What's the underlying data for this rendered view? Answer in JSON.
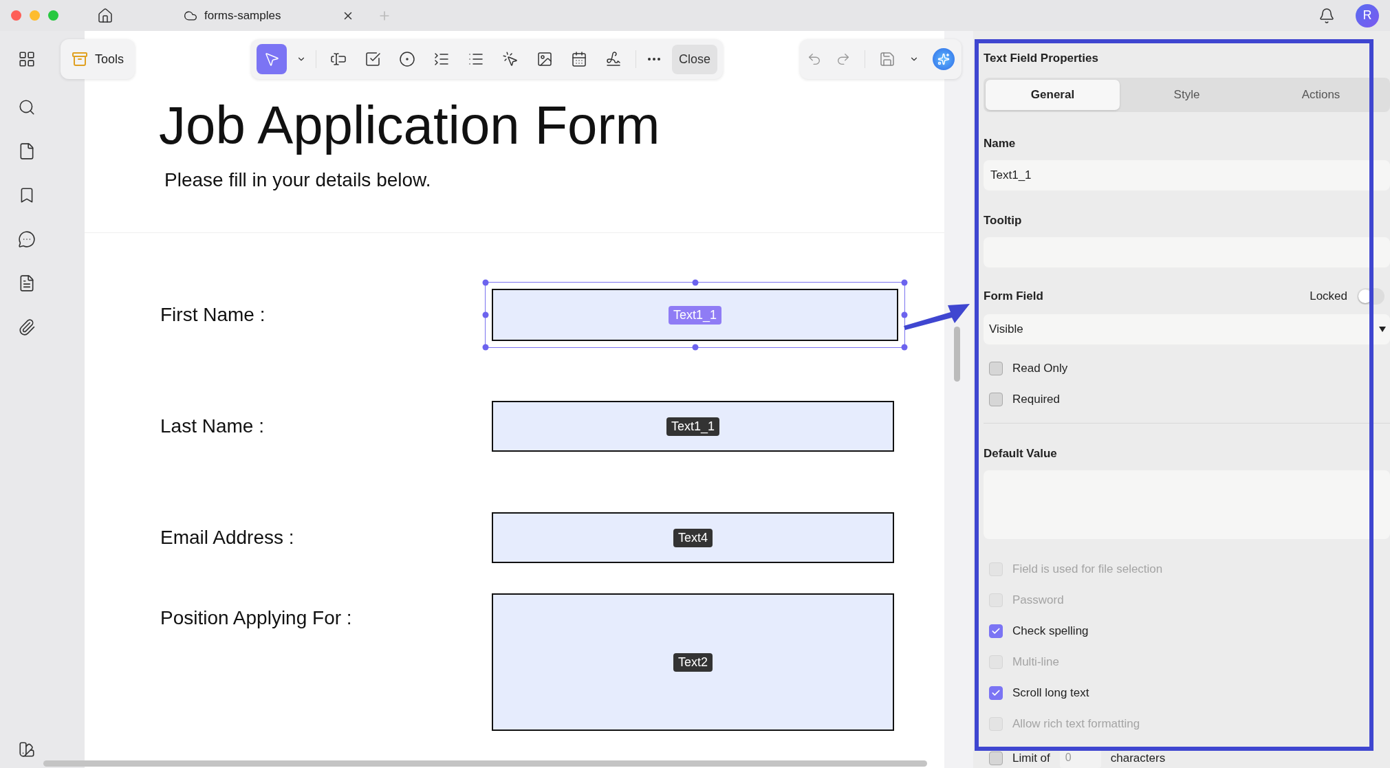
{
  "window": {
    "tab_title": "forms-samples",
    "avatar": "R"
  },
  "toolbar": {
    "tools_label": "Tools",
    "close_label": "Close",
    "tools": [
      {
        "kind": "select",
        "selected": true
      },
      {
        "kind": "text-field",
        "selected": false
      },
      {
        "kind": "checkbox",
        "selected": false
      },
      {
        "kind": "radio",
        "selected": false
      },
      {
        "kind": "combo",
        "selected": false
      },
      {
        "kind": "list",
        "selected": false
      },
      {
        "kind": "button",
        "selected": false
      },
      {
        "kind": "image",
        "selected": false
      },
      {
        "kind": "date",
        "selected": false
      },
      {
        "kind": "signature",
        "selected": false
      }
    ]
  },
  "document": {
    "title": "Job Application Form",
    "subtitle": "Please fill in your details below.",
    "fields": [
      {
        "label": "First Name :",
        "field_name": "Text1_1",
        "selected": true,
        "kind": "line"
      },
      {
        "label": "Last Name :",
        "field_name": "Text1_1",
        "selected": false,
        "kind": "line"
      },
      {
        "label": "Email Address :",
        "field_name": "Text4",
        "selected": false,
        "kind": "line"
      },
      {
        "label": "Position Applying For :",
        "field_name": "Text2",
        "selected": false,
        "kind": "box"
      }
    ]
  },
  "panel": {
    "title": "Text Field Properties",
    "tabs": [
      {
        "label": "General",
        "selected": true
      },
      {
        "label": "Style",
        "selected": false
      },
      {
        "label": "Actions",
        "selected": false
      }
    ],
    "name_label": "Name",
    "name_value": "Text1_1",
    "tooltip_label": "Tooltip",
    "form_field_label": "Form Field",
    "locked_label": "Locked",
    "locked": false,
    "visibility": "Visible",
    "options": [
      {
        "label": "Read Only",
        "checked": false,
        "disabled": false
      },
      {
        "label": "Required",
        "checked": false,
        "disabled": false
      }
    ],
    "default_value_label": "Default Value",
    "text_options": [
      {
        "label": "Field is used for file selection",
        "checked": false,
        "disabled": true
      },
      {
        "label": "Password",
        "checked": false,
        "disabled": true
      },
      {
        "label": "Check spelling",
        "checked": true,
        "disabled": false
      },
      {
        "label": "Multi-line",
        "checked": false,
        "disabled": true
      },
      {
        "label": "Scroll long text",
        "checked": true,
        "disabled": false
      },
      {
        "label": "Allow rich text formatting",
        "checked": false,
        "disabled": true
      }
    ],
    "limit": {
      "before": "Limit of",
      "value": "0",
      "after": "characters",
      "checked": false
    }
  }
}
